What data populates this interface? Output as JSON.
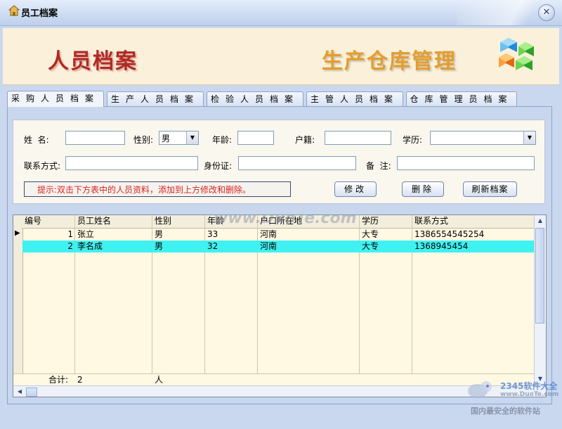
{
  "window": {
    "title": "员工档案",
    "close_glyph": "✕"
  },
  "banner": {
    "left_text": "人员档案",
    "right_text": "生产仓库管理"
  },
  "tabs": [
    {
      "label": "采购人员档案",
      "active": true
    },
    {
      "label": "生产人员档案",
      "active": false
    },
    {
      "label": "检验人员档案",
      "active": false
    },
    {
      "label": "主管人员档案",
      "active": false
    },
    {
      "label": "仓库管理员档案",
      "active": false
    }
  ],
  "form": {
    "name": {
      "label": "姓  名:",
      "value": ""
    },
    "gender": {
      "label": "性别:",
      "value": "男"
    },
    "age": {
      "label": "年龄:",
      "value": ""
    },
    "hukou": {
      "label": "户籍:",
      "value": ""
    },
    "education": {
      "label": "学历:",
      "value": ""
    },
    "contact": {
      "label": "联系方式:",
      "value": ""
    },
    "id_card": {
      "label": "身份证:",
      "value": ""
    },
    "notes": {
      "label": "备  注:",
      "value": ""
    },
    "tip": "提示:双击下方表中的人员资料，添加到上方修改和删除。",
    "buttons": {
      "modify": "修改",
      "delete": "删除",
      "refresh": "刷新档案"
    }
  },
  "grid": {
    "columns": [
      "编号",
      "员工姓名",
      "性别",
      "年龄",
      "户口所在地",
      "学历",
      "联系方式"
    ],
    "rows": [
      {
        "id": "1",
        "name": "张立",
        "gender": "男",
        "age": "33",
        "hukou": "河南",
        "education": "大专",
        "contact": "1386554545254",
        "selected": false
      },
      {
        "id": "2",
        "name": "李名成",
        "gender": "男",
        "age": "32",
        "hukou": "河南",
        "education": "大专",
        "contact": "1368945454",
        "selected": true
      }
    ],
    "footer": {
      "label": "合计:",
      "count": "2",
      "unit": "人"
    }
  },
  "watermarks": {
    "center": "www.DuoTe.com",
    "corner_brand": "2345软件大全",
    "corner_url": "www.DuoTe.com",
    "corner_slogan": "国内最安全的软件站"
  },
  "colors": {
    "selected_row": "#3FF1F1",
    "tip_text": "#DD2222",
    "banner_left": "#B02A22",
    "banner_right": "#E49D2E"
  }
}
